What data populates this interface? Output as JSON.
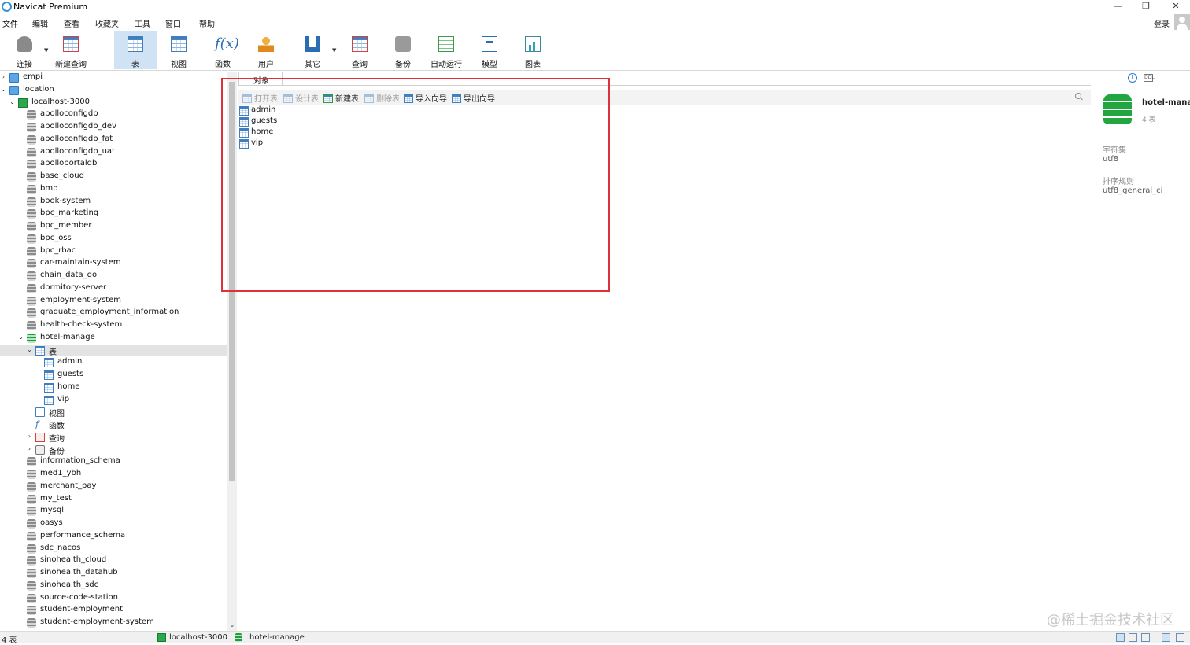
{
  "window": {
    "title": "Navicat Premium"
  },
  "menu": [
    "文件",
    "编辑",
    "查看",
    "收藏夹",
    "工具",
    "窗口",
    "帮助"
  ],
  "account": {
    "login_label": "登录"
  },
  "toolbar": [
    {
      "label": "连接",
      "icon": "connection-icon"
    },
    {
      "label": "新建查询",
      "icon": "new-query-icon"
    },
    {
      "label": "表",
      "icon": "table-icon",
      "active": true
    },
    {
      "label": "视图",
      "icon": "view-icon"
    },
    {
      "label": "函数",
      "icon": "function-icon"
    },
    {
      "label": "用户",
      "icon": "user-icon"
    },
    {
      "label": "其它",
      "icon": "tools-icon"
    },
    {
      "label": "查询",
      "icon": "query-icon"
    },
    {
      "label": "备份",
      "icon": "backup-icon"
    },
    {
      "label": "自动运行",
      "icon": "auto-run-icon"
    },
    {
      "label": "模型",
      "icon": "model-icon"
    },
    {
      "label": "图表",
      "icon": "chart-icon"
    }
  ],
  "tree": [
    {
      "label": "empi",
      "type": "folder",
      "level": 0,
      "arrow": "›"
    },
    {
      "label": "location",
      "type": "folder",
      "level": 0,
      "arrow": "⌄"
    },
    {
      "label": "localhost-3000",
      "type": "connection",
      "level": 1,
      "arrow": "⌄"
    },
    {
      "label": "apolloconfigdb",
      "type": "db",
      "level": 2
    },
    {
      "label": "apolloconfigdb_dev",
      "type": "db",
      "level": 2
    },
    {
      "label": "apolloconfigdb_fat",
      "type": "db",
      "level": 2
    },
    {
      "label": "apolloconfigdb_uat",
      "type": "db",
      "level": 2
    },
    {
      "label": "apolloportaldb",
      "type": "db",
      "level": 2
    },
    {
      "label": "base_cloud",
      "type": "db",
      "level": 2
    },
    {
      "label": "bmp",
      "type": "db",
      "level": 2
    },
    {
      "label": "book-system",
      "type": "db",
      "level": 2
    },
    {
      "label": "bpc_marketing",
      "type": "db",
      "level": 2
    },
    {
      "label": "bpc_member",
      "type": "db",
      "level": 2
    },
    {
      "label": "bpc_oss",
      "type": "db",
      "level": 2
    },
    {
      "label": "bpc_rbac",
      "type": "db",
      "level": 2
    },
    {
      "label": "car-maintain-system",
      "type": "db",
      "level": 2
    },
    {
      "label": "chain_data_do",
      "type": "db",
      "level": 2
    },
    {
      "label": "dormitory-server",
      "type": "db",
      "level": 2
    },
    {
      "label": "employment-system",
      "type": "db",
      "level": 2
    },
    {
      "label": "graduate_employment_information",
      "type": "db",
      "level": 2
    },
    {
      "label": "health-check-system",
      "type": "db",
      "level": 2
    },
    {
      "label": "hotel-manage",
      "type": "db-open",
      "level": 2,
      "arrow": "⌄"
    },
    {
      "label": "表",
      "type": "tables",
      "level": 3,
      "arrow": "⌄",
      "selected": true
    },
    {
      "label": "admin",
      "type": "table",
      "level": 4
    },
    {
      "label": "guests",
      "type": "table",
      "level": 4
    },
    {
      "label": "home",
      "type": "table",
      "level": 4
    },
    {
      "label": "vip",
      "type": "table",
      "level": 4
    },
    {
      "label": "视图",
      "type": "views",
      "level": 3
    },
    {
      "label": "函数",
      "type": "functions",
      "level": 3
    },
    {
      "label": "查询",
      "type": "queries",
      "level": 3,
      "arrow": "›"
    },
    {
      "label": "备份",
      "type": "backups",
      "level": 3,
      "arrow": "›"
    },
    {
      "label": "information_schema",
      "type": "db",
      "level": 2
    },
    {
      "label": "med1_ybh",
      "type": "db",
      "level": 2
    },
    {
      "label": "merchant_pay",
      "type": "db",
      "level": 2
    },
    {
      "label": "my_test",
      "type": "db",
      "level": 2
    },
    {
      "label": "mysql",
      "type": "db",
      "level": 2
    },
    {
      "label": "oasys",
      "type": "db",
      "level": 2
    },
    {
      "label": "performance_schema",
      "type": "db",
      "level": 2
    },
    {
      "label": "sdc_nacos",
      "type": "db",
      "level": 2
    },
    {
      "label": "sinohealth_cloud",
      "type": "db",
      "level": 2
    },
    {
      "label": "sinohealth_datahub",
      "type": "db",
      "level": 2
    },
    {
      "label": "sinohealth_sdc",
      "type": "db",
      "level": 2
    },
    {
      "label": "source-code-station",
      "type": "db",
      "level": 2
    },
    {
      "label": "student-employment",
      "type": "db",
      "level": 2
    },
    {
      "label": "student-employment-system",
      "type": "db",
      "level": 2
    }
  ],
  "objects_tab": {
    "label": "对象"
  },
  "object_toolbar": [
    {
      "label": "打开表",
      "disabled": true
    },
    {
      "label": "设计表",
      "disabled": true
    },
    {
      "label": "新建表",
      "disabled": false
    },
    {
      "label": "删除表",
      "disabled": true
    },
    {
      "label": "导入向导",
      "disabled": false
    },
    {
      "label": "导出向导",
      "disabled": false
    }
  ],
  "objects": [
    "admin",
    "guests",
    "home",
    "vip"
  ],
  "info": {
    "db_name": "hotel-manage",
    "table_count": "4 表",
    "charset_label": "字符集",
    "charset_value": "utf8",
    "collation_label": "排序规则",
    "collation_value": "utf8_general_ci"
  },
  "status": {
    "count": "4 表",
    "connection": "localhost-3000",
    "database": "hotel-manage"
  },
  "watermark": "@稀土掘金技术社区",
  "colors": {
    "highlight": "#e0313a",
    "selection": "#e3e3e3",
    "accent": "#3f7fc0",
    "db_green": "#1e9e3a"
  }
}
